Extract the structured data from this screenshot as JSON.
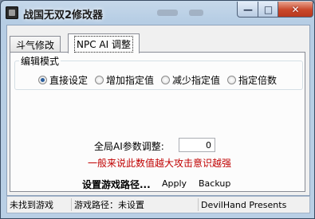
{
  "window": {
    "title": "战国无双2修改器",
    "controls": {
      "minimize": "—",
      "maximize": "□",
      "close": "✕"
    }
  },
  "tabs": [
    {
      "label": "斗气修改",
      "selected": false
    },
    {
      "label": "NPC AI 调整",
      "selected": true
    }
  ],
  "edit_mode": {
    "legend": "编辑模式",
    "options": [
      {
        "label": "直接设定",
        "checked": true
      },
      {
        "label": "增加指定值",
        "checked": false
      },
      {
        "label": "减少指定值",
        "checked": false
      },
      {
        "label": "指定倍数",
        "checked": false
      }
    ]
  },
  "ai_param": {
    "label": "全局AI参数调整:",
    "value": "0"
  },
  "warning": "一般来说此数值越大攻击意识越强",
  "path_setting": {
    "label": "设置游戏路径...",
    "apply": "Apply",
    "backup": "Backup"
  },
  "statusbar": {
    "game_status": "未找到游戏",
    "game_path": "游戏路径：未设置",
    "credit": "DevilHand Presents"
  },
  "colors": {
    "warning": "#c00000",
    "titlebar": "#b6cde4",
    "close_button": "#c9472a"
  }
}
